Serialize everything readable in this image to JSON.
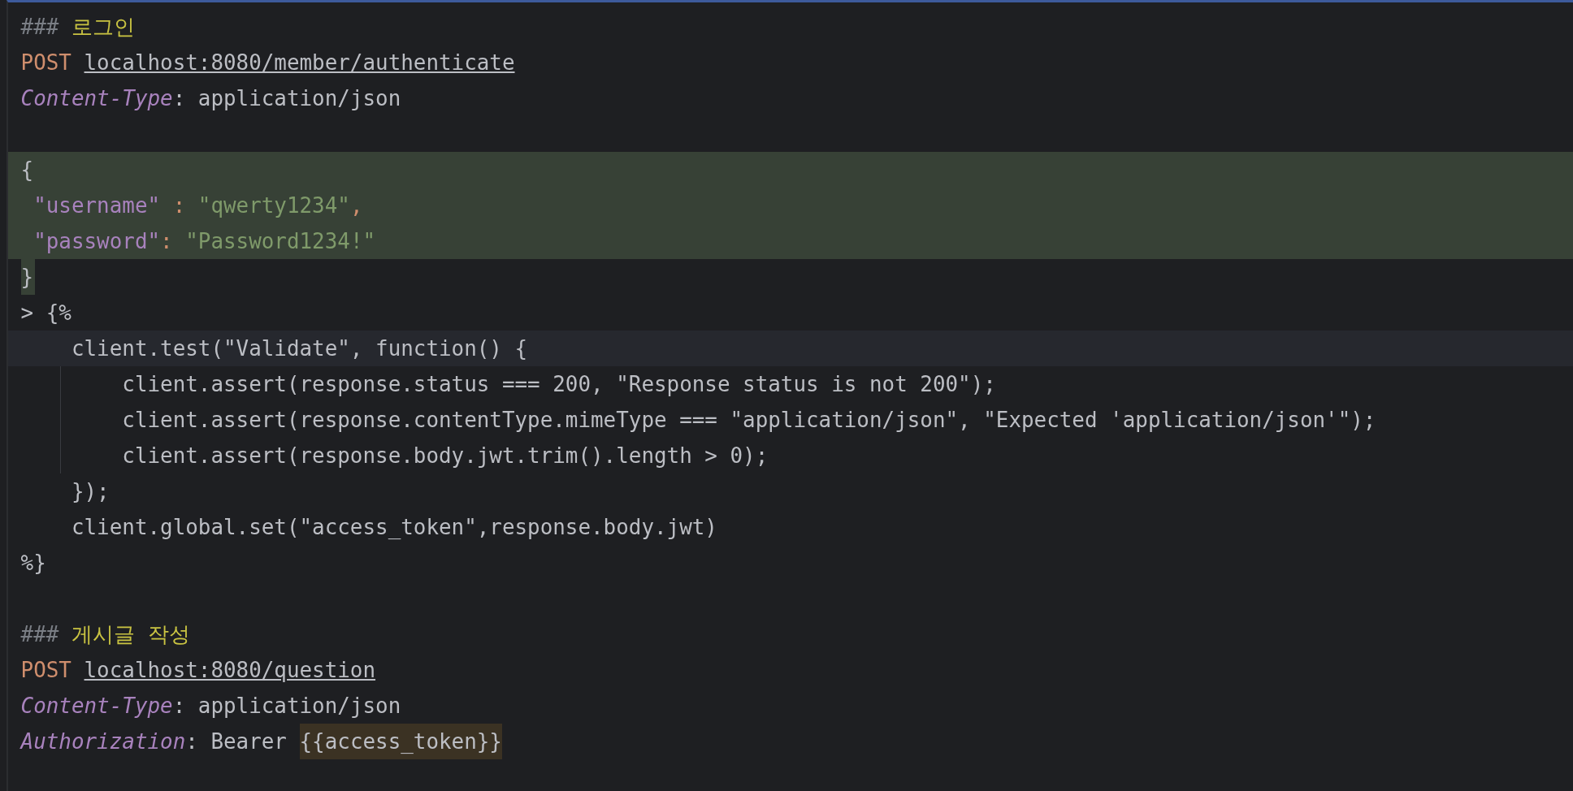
{
  "editor": {
    "lines": [
      {
        "highlighted": false,
        "current": false,
        "guide": false,
        "tokens": [
          {
            "kind": "comment",
            "text": "### "
          },
          {
            "kind": "heading",
            "text": "로그인"
          }
        ]
      },
      {
        "highlighted": false,
        "current": false,
        "guide": false,
        "tokens": [
          {
            "kind": "method",
            "text": "POST "
          },
          {
            "kind": "url",
            "text": "localhost:8080/member/authenticate"
          }
        ]
      },
      {
        "highlighted": false,
        "current": false,
        "guide": false,
        "tokens": [
          {
            "kind": "header",
            "text": "Content-Type"
          },
          {
            "kind": "plain",
            "text": ": application/json"
          }
        ]
      },
      {
        "highlighted": false,
        "current": false,
        "guide": false
      },
      {
        "highlighted": true,
        "current": false,
        "guide": false,
        "tokens": [
          {
            "kind": "plain",
            "text": "{"
          }
        ]
      },
      {
        "highlighted": true,
        "current": false,
        "guide": false,
        "tokens": [
          {
            "kind": "key",
            "text": " \"username\""
          },
          {
            "kind": "colon",
            "text": " : "
          },
          {
            "kind": "string",
            "text": "\"qwerty1234\""
          },
          {
            "kind": "colon",
            "text": ","
          }
        ]
      },
      {
        "highlighted": true,
        "current": false,
        "guide": false,
        "tokens": [
          {
            "kind": "key",
            "text": " \"password\""
          },
          {
            "kind": "colon",
            "text": ": "
          },
          {
            "kind": "string",
            "text": "\"Password1234!\""
          }
        ]
      },
      {
        "highlighted": false,
        "current": false,
        "guide": false,
        "tokens": [
          {
            "kind": "injected",
            "text": "}"
          }
        ]
      },
      {
        "highlighted": false,
        "current": false,
        "guide": false,
        "tokens": [
          {
            "kind": "plain",
            "text": "> {%"
          }
        ]
      },
      {
        "highlighted": false,
        "current": true,
        "guide": false,
        "tokens": [
          {
            "kind": "plain",
            "text": "    client.test(\"Validate\", function() {"
          }
        ]
      },
      {
        "highlighted": false,
        "current": false,
        "guide": true,
        "tokens": [
          {
            "kind": "plain",
            "text": "        client.assert(response.status === 200, \"Response status is not 200\");"
          }
        ]
      },
      {
        "highlighted": false,
        "current": false,
        "guide": true,
        "tokens": [
          {
            "kind": "plain",
            "text": "        client.assert(response.contentType.mimeType === \"application/json\", \"Expected 'application/json'\");"
          }
        ]
      },
      {
        "highlighted": false,
        "current": false,
        "guide": true,
        "tokens": [
          {
            "kind": "plain",
            "text": "        client.assert(response.body.jwt.trim().length > 0);"
          }
        ]
      },
      {
        "highlighted": false,
        "current": false,
        "guide": false,
        "tokens": [
          {
            "kind": "plain",
            "text": "    });"
          }
        ]
      },
      {
        "highlighted": false,
        "current": false,
        "guide": false,
        "tokens": [
          {
            "kind": "plain",
            "text": "    client.global.set(\"access_token\",response.body.jwt)"
          }
        ]
      },
      {
        "highlighted": false,
        "current": false,
        "guide": false,
        "tokens": [
          {
            "kind": "plain",
            "text": "%}"
          }
        ]
      },
      {
        "highlighted": false,
        "current": false,
        "guide": false
      },
      {
        "highlighted": false,
        "current": false,
        "guide": false,
        "tokens": [
          {
            "kind": "comment",
            "text": "### "
          },
          {
            "kind": "heading",
            "text": "게시글 작성"
          }
        ]
      },
      {
        "highlighted": false,
        "current": false,
        "guide": false,
        "tokens": [
          {
            "kind": "method",
            "text": "POST "
          },
          {
            "kind": "url",
            "text": "localhost:8080/question"
          }
        ]
      },
      {
        "highlighted": false,
        "current": false,
        "guide": false,
        "tokens": [
          {
            "kind": "header",
            "text": "Content-Type"
          },
          {
            "kind": "plain",
            "text": ": application/json"
          }
        ]
      },
      {
        "highlighted": false,
        "current": false,
        "guide": false,
        "tokens": [
          {
            "kind": "header",
            "text": "Authorization"
          },
          {
            "kind": "plain",
            "text": ": Bearer "
          },
          {
            "kind": "variable",
            "text": "{{access_token}}"
          }
        ]
      }
    ]
  }
}
